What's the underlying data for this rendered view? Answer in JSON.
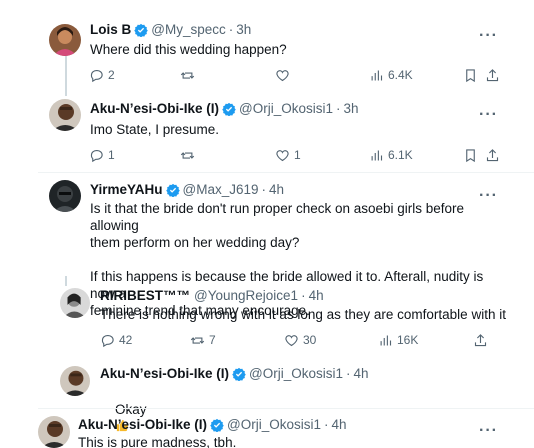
{
  "tweets": [
    {
      "name": "Lois B",
      "handle": "@My_specc",
      "time": "3h",
      "text": "Where did this wedding happen?",
      "replies": "2",
      "retweets": "",
      "likes": "",
      "views": "6.4K"
    },
    {
      "name": "Aku-N’esi-Obi-Ike (I)",
      "handle": "@Orji_Okosisi1",
      "time": "3h",
      "text": "Imo State, I presume.",
      "replies": "1",
      "retweets": "",
      "likes": "1",
      "views": "6.1K"
    },
    {
      "name": "YirmeYAHu",
      "handle": "@Max_J619",
      "time": "4h",
      "text": "Is it that the bride don't run proper check on asoebi girls before allowing\nthem perform on her wedding day?\n\nIf this happens is because the bride allowed it to. Afterall, nudity is now a\nfeminine trend that many encourage."
    },
    {
      "name": "RIRIBEST™™",
      "handle": "@YoungRejoice1",
      "time": "4h",
      "text": "There is nothing wrong with it as long as they are comfortable with it",
      "replies": "42",
      "retweets": "7",
      "likes": "30",
      "views": "16K"
    },
    {
      "name": "Aku-N’esi-Obi-Ike (I)",
      "handle": "@Orji_Okosisi1",
      "time": "4h",
      "text": "Okay",
      "emoji": "thumbs-up"
    },
    {
      "name": "Aku-N’esi-Obi-Ike (I)",
      "handle": "@Orji_Okosisi1",
      "time": "4h",
      "text": "This is pure madness, tbh."
    }
  ],
  "ui": {
    "dot": "·",
    "more": "···"
  },
  "colors": {
    "verified": "#1d9bf0",
    "muted": "#536471",
    "thread_line": "#cfd9de"
  }
}
